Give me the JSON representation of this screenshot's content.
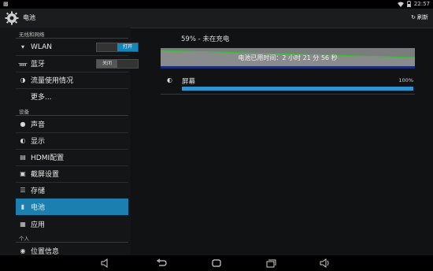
{
  "status_bar": {
    "time": "22:57",
    "icons": [
      "notification-icon",
      "wifi-icon",
      "battery-icon"
    ]
  },
  "action_bar": {
    "title": "电池",
    "refresh_label": "刷新",
    "app_icon": "settings-gear-icon"
  },
  "sidebar": {
    "sections": {
      "wireless": "无线和网络",
      "device": "设备",
      "personal": "个人"
    },
    "items": [
      {
        "label": "WLAN",
        "icon": "wifi-icon",
        "toggle": "打开"
      },
      {
        "label": "蓝牙",
        "icon": "bluetooth-icon",
        "toggle": "关闭"
      },
      {
        "label": "流量使用情况",
        "icon": "data-usage-icon"
      },
      {
        "label": "更多...",
        "icon": ""
      },
      {
        "label": "声音",
        "icon": "sound-icon"
      },
      {
        "label": "显示",
        "icon": "display-icon"
      },
      {
        "label": "HDMI配置",
        "icon": "hdmi-icon"
      },
      {
        "label": "截屏设置",
        "icon": "screenshot-icon"
      },
      {
        "label": "存储",
        "icon": "storage-icon"
      },
      {
        "label": "电池",
        "icon": "battery-icon",
        "active": true
      },
      {
        "label": "应用",
        "icon": "apps-icon"
      },
      {
        "label": "位置信息",
        "icon": "location-icon"
      }
    ]
  },
  "content": {
    "battery_status": "59% - 未在充电",
    "graph_caption": "电池已用时间：2 小时 21 分 56 秒",
    "usage_rows": [
      {
        "label": "屏幕",
        "icon": "display-icon",
        "percent_text": "100%",
        "fraction": 1.0
      }
    ]
  },
  "colors": {
    "accent": "#1b80b0",
    "bar_fill": "#2d95d0",
    "graph_line": "#3dbb3d"
  },
  "nav_bar": {
    "buttons": [
      "volume-down-icon",
      "back-icon",
      "home-icon",
      "recent-apps-icon",
      "volume-up-icon"
    ]
  }
}
